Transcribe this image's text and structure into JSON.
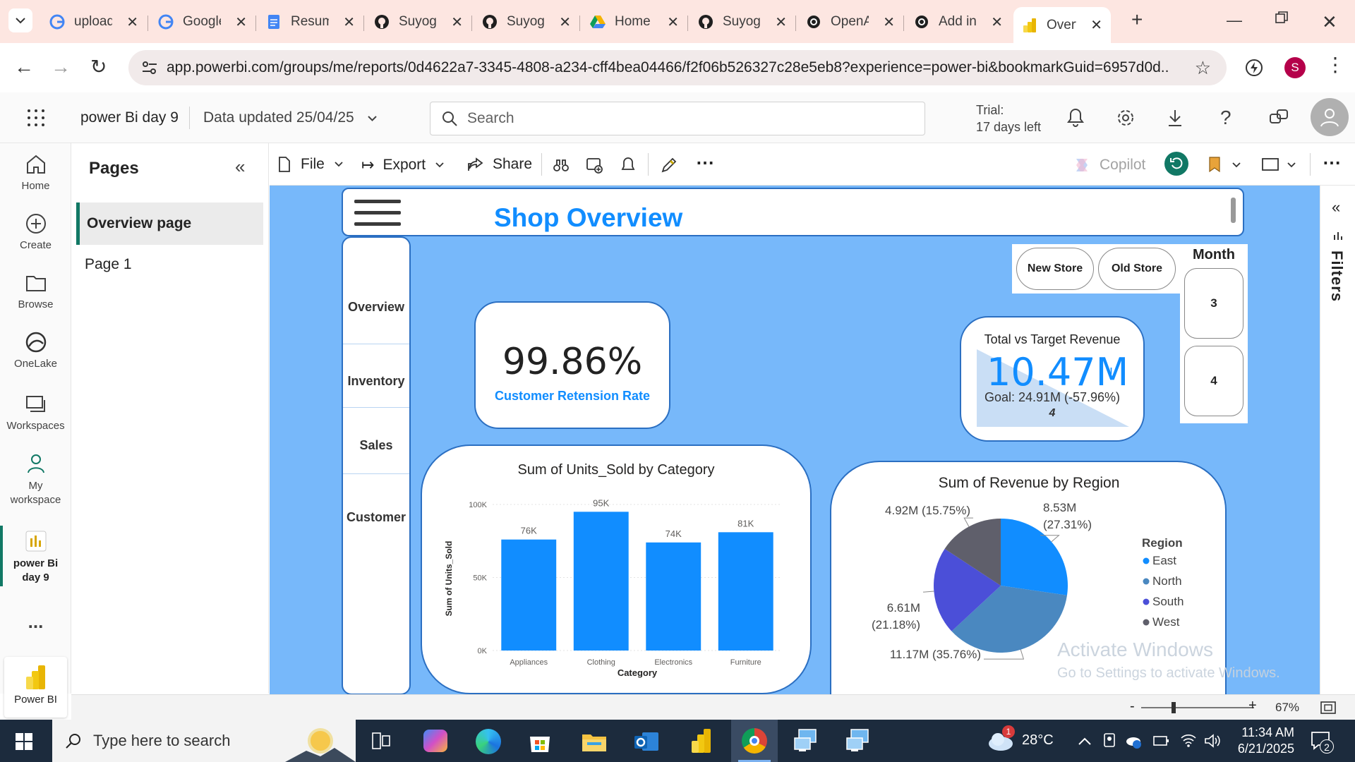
{
  "browser": {
    "tabs": [
      {
        "label": "upload",
        "icon": "google-icon"
      },
      {
        "label": "Google",
        "icon": "google-icon"
      },
      {
        "label": "Resume",
        "icon": "docs-icon"
      },
      {
        "label": "Suyog",
        "icon": "github-icon"
      },
      {
        "label": "Suyog",
        "icon": "github-icon"
      },
      {
        "label": "Home",
        "icon": "drive-icon"
      },
      {
        "label": "Suyog",
        "icon": "github-icon"
      },
      {
        "label": "OpenAI",
        "icon": "openai-icon"
      },
      {
        "label": "Add in",
        "icon": "openai-icon"
      },
      {
        "label": "Overview",
        "icon": "powerbi-icon",
        "active": true
      }
    ],
    "url": "app.powerbi.com/groups/me/reports/0d4622a7-3345-4808-a234-cff4bea04466/f2f06b526327c28e5eb8?experience=power-bi&bookmarkGuid=6957d0d...",
    "profile_initial": "S"
  },
  "pbi": {
    "workspace": "power Bi day 9",
    "data_updated": "Data updated 25/04/25",
    "search_placeholder": "Search",
    "trial_line1": "Trial:",
    "trial_line2": "17 days left"
  },
  "leftnav": [
    {
      "label": "Home",
      "icon": "home-icon"
    },
    {
      "label": "Create",
      "icon": "plus-circle-icon"
    },
    {
      "label": "Browse",
      "icon": "folder-icon"
    },
    {
      "label": "OneLake",
      "icon": "onelake-icon"
    },
    {
      "label": "Workspaces",
      "icon": "workspaces-icon"
    },
    {
      "label_1": "My",
      "label_2": "workspace",
      "icon": "person-icon"
    },
    {
      "label_1": "power Bi",
      "label_2": "day 9",
      "icon": "report-icon"
    }
  ],
  "leftnav_more": "...",
  "powerbi_label": "Power BI",
  "pages": {
    "title": "Pages",
    "items": [
      "Overview page",
      "Page 1"
    ]
  },
  "toolbar": {
    "file": "File",
    "export": "Export",
    "share": "Share",
    "copilot": "Copilot"
  },
  "report": {
    "title": "Shop Overview",
    "side_nav": [
      "Overview",
      "Inventory",
      "Sales",
      "Customer"
    ],
    "store_buttons": [
      "New Store",
      "Old Store"
    ],
    "month_slicer": {
      "title": "Month",
      "items": [
        "3",
        "4"
      ]
    },
    "retention": {
      "value": "99.86%",
      "label": "Customer Retension Rate"
    },
    "kpi": {
      "title": "Total vs Target Revenue",
      "value": "10.47M",
      "goal": "Goal: 24.91M (-57.96%)",
      "sub": "4",
      "indicator": "!"
    },
    "watermark_1": "Activate Windows",
    "watermark_2": "Go to Settings to activate Windows."
  },
  "chart_data": [
    {
      "type": "bar",
      "title": "Sum of Units_Sold by Category",
      "xlabel": "Category",
      "ylabel": "Sum of Units_Sold",
      "categories": [
        "Appliances",
        "Clothing",
        "Electronics",
        "Furniture"
      ],
      "values": [
        76000,
        95000,
        74000,
        81000
      ],
      "data_labels": [
        "76K",
        "95K",
        "74K",
        "81K"
      ],
      "yticks": [
        "0K",
        "50K",
        "100K"
      ],
      "ylim": [
        0,
        100000
      ],
      "color": "#118dff"
    },
    {
      "type": "pie",
      "title": "Sum of Revenue by Region",
      "legend_title": "Region",
      "labels": [
        "East",
        "North",
        "South",
        "West"
      ],
      "values": [
        8.53,
        11.17,
        6.61,
        4.92
      ],
      "data_labels": [
        {
          "value": "8.53M",
          "pct": "(27.31%)"
        },
        {
          "value": "11.17M",
          "pct": "(35.76%)"
        },
        {
          "value": "6.61M",
          "pct": "(21.18%)"
        },
        {
          "value": "4.92M",
          "pct": "(15.75%)"
        }
      ],
      "colors": [
        "#118dff",
        "#4a88c0",
        "#4b4fd8",
        "#5f5f6b"
      ]
    }
  ],
  "status": {
    "zoom": "67%"
  },
  "taskbar": {
    "search_placeholder": "Type here to search",
    "temperature": "28°C",
    "weather_badge": "1",
    "time": "11:34 AM",
    "date": "6/21/2025",
    "notifications": "2"
  },
  "filters_label": "Filters"
}
